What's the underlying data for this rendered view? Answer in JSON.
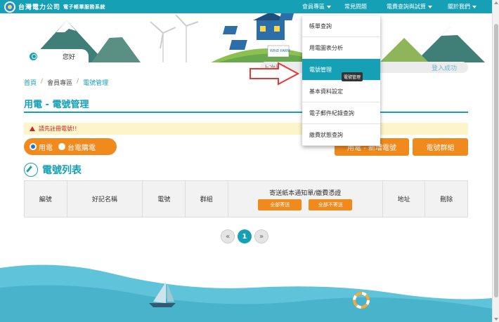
{
  "header": {
    "brand": "台灣電力公司",
    "subtitle": "電子帳單服務系統",
    "nav": [
      {
        "label": "會員專區",
        "caret": true
      },
      {
        "label": "常見問題",
        "caret": false
      },
      {
        "label": "電費查詢與試算",
        "caret": true
      },
      {
        "label": "關於我們",
        "caret": true
      }
    ]
  },
  "banner": {
    "sign": "WIND FARM"
  },
  "greeting": "您好",
  "login_bar": {
    "left": "上次登入",
    "right": "登入成功"
  },
  "breadcrumb": [
    "首頁",
    "會員專區",
    "電號管理"
  ],
  "page_title": "用電 - 電號管理",
  "alert": "請先註冊電號!!",
  "toggle": {
    "options": [
      "用電",
      "台電購電"
    ],
    "selected": 0
  },
  "buttons": {
    "add": "用電 - 新增電號",
    "group": "電號群組"
  },
  "section_title": "電號列表",
  "table": {
    "columns": [
      "編號",
      "好記名稱",
      "電號",
      "群組",
      "寄送紙本通知單/繳費憑證",
      "地址",
      "刪除"
    ],
    "sub_buttons": [
      "全部寄送",
      "全部不寄送"
    ],
    "rows": []
  },
  "pagination": {
    "prev": "«",
    "current": "1",
    "next": "»"
  },
  "dropdown": {
    "items": [
      "帳單查詢",
      "用電圖表分析",
      "電號管理",
      "基本資料設定",
      "電子郵件紀錄查詢",
      "繳費狀態查詢"
    ],
    "active": 2,
    "tooltip": "電號管理"
  },
  "colors": {
    "primary": "#16a0b5",
    "accent": "#f08a1c",
    "alert_bg": "#fdf5c9"
  }
}
